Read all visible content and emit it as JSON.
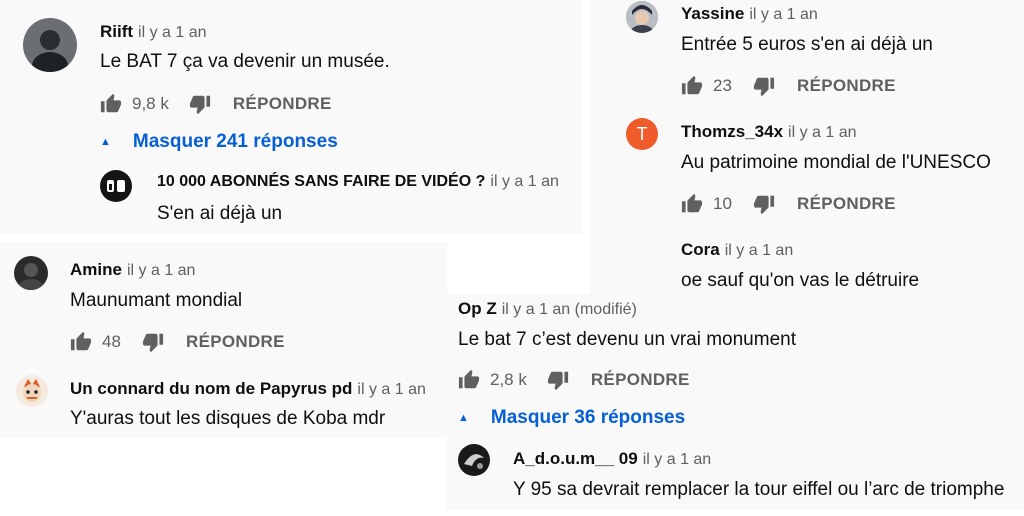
{
  "comments": {
    "riift": {
      "author": "Riift",
      "time": "il y a 1 an",
      "text": "Le BAT 7 ça va devenir un musée.",
      "likes": "9,8 k",
      "reply": "RÉPONDRE",
      "toggle": "Masquer 241 réponses"
    },
    "abonnes": {
      "author": "10 000 ABONNÉS SANS FAIRE DE VIDÉO ?",
      "time": "il y a 1 an",
      "text": "S'en ai déjà un"
    },
    "yassine": {
      "author": "Yassine",
      "time": "il y a 1 an",
      "text": "Entrée 5 euros s'en ai déjà un",
      "likes": "23",
      "reply": "RÉPONDRE"
    },
    "thomzs": {
      "author": "Thomzs_34x",
      "time": "il y a 1 an",
      "avatar_letter": "T",
      "text": "Au patrimoine mondial de l'UNESCO",
      "likes": "10",
      "reply": "RÉPONDRE"
    },
    "cora": {
      "author": "Cora",
      "time": "il y a 1 an",
      "text": "oe sauf qu'on vas le détruire"
    },
    "amine": {
      "author": "Amine",
      "time": "il y a 1 an",
      "text": "Maunumant mondial",
      "likes": "48",
      "reply": "RÉPONDRE"
    },
    "papyrus": {
      "author": "Un connard du nom de Papyrus pd",
      "time": "il y a 1 an",
      "text": "Y'auras tout les disques de Koba mdr"
    },
    "opz": {
      "author": "Op Z",
      "time": "il y a 1 an (modifié)",
      "text": "Le bat 7 c’est devenu un vrai monument",
      "likes": "2,8 k",
      "reply": "RÉPONDRE",
      "toggle": "Masquer 36 réponses"
    },
    "adoum": {
      "author": "A_d.o.u.m__ 09",
      "time": "il y a 1 an",
      "text": "Y 95 sa devrait remplacer la tour eiffel ou l’arc de triomphe"
    }
  },
  "colors": {
    "link_blue": "#065fd4",
    "secondary_text": "#606060",
    "panel_bg": "#f9f9f9",
    "avatar_orange": "#ef5b2b"
  },
  "icons": [
    "thumb-up-icon",
    "thumb-down-icon",
    "caret-up-icon"
  ]
}
